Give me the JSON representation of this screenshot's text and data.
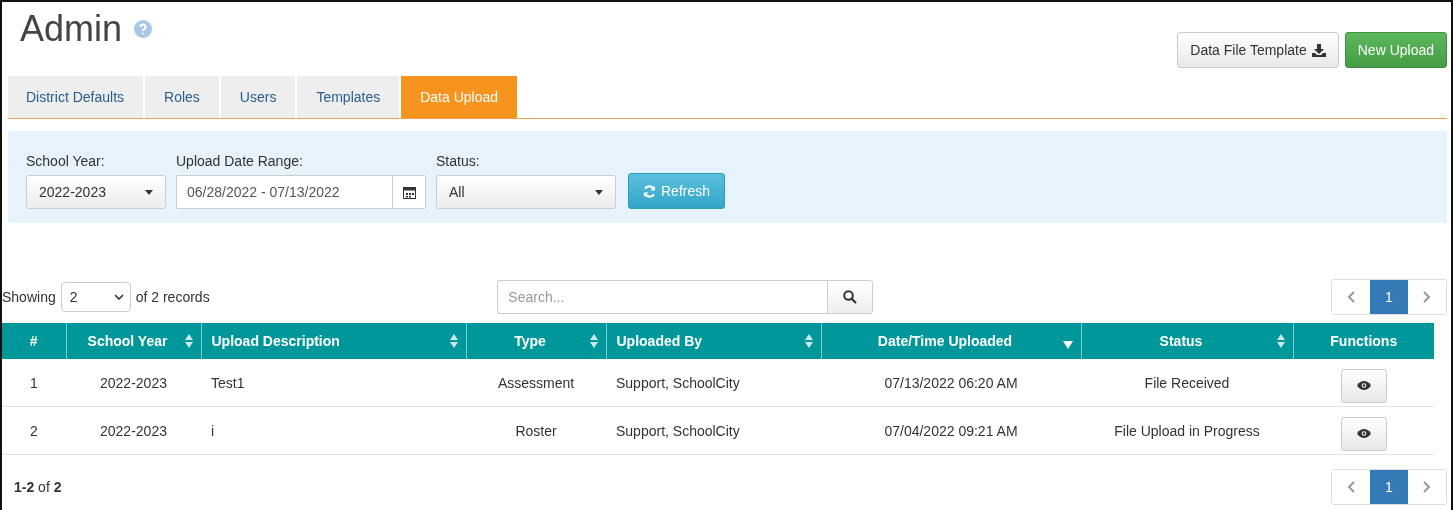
{
  "page_title": "Admin",
  "header_buttons": [
    {
      "label": "Data File Template",
      "kind": "default"
    },
    {
      "label": "New Upload",
      "kind": "success"
    }
  ],
  "tabs": [
    {
      "label": "District Defaults",
      "selected": false
    },
    {
      "label": "Roles",
      "selected": false
    },
    {
      "label": "Users",
      "selected": false
    },
    {
      "label": "Templates",
      "selected": false
    },
    {
      "label": "Data Upload",
      "selected": true
    }
  ],
  "filters": {
    "school_year": {
      "label": "School Year:",
      "value": "2022-2023"
    },
    "date_range": {
      "label": "Upload Date Range:",
      "value": "06/28/2022 - 07/13/2022"
    },
    "status": {
      "label": "Status:",
      "value": "All"
    },
    "refresh_button": "Refresh"
  },
  "records": {
    "prefix": "Showing",
    "page_size": "2",
    "suffix": "of 2 records"
  },
  "search": {
    "placeholder": "Search..."
  },
  "pagination_top": [
    {
      "label": "1",
      "selected": true
    }
  ],
  "table": {
    "columns": [
      {
        "label": "#",
        "sortable": false
      },
      {
        "label": "School Year",
        "sortable": true,
        "sorted": false
      },
      {
        "label": "Upload Description",
        "sortable": true,
        "sorted": false
      },
      {
        "label": "Type",
        "sortable": true,
        "sorted": false
      },
      {
        "label": "Uploaded By",
        "sortable": true,
        "sorted": false
      },
      {
        "label": "Date/Time Uploaded",
        "sortable": true,
        "sorted": true
      },
      {
        "label": "Status",
        "sortable": true,
        "sorted": false
      },
      {
        "label": "Functions",
        "sortable": false
      }
    ],
    "rows": [
      [
        "1",
        "2022-2023",
        "Test1",
        "Assessment",
        "Support, SchoolCity",
        "07/13/2022 06:20 AM",
        "File Received"
      ],
      [
        "2",
        "2022-2023",
        "i",
        "Roster",
        "Support, SchoolCity",
        "07/04/2022 09:21 AM",
        "File Upload in Progress"
      ]
    ]
  },
  "footer_count": "**1-2** of **2**",
  "pagination_bottom": [
    {
      "label": "1",
      "selected": true
    }
  ]
}
